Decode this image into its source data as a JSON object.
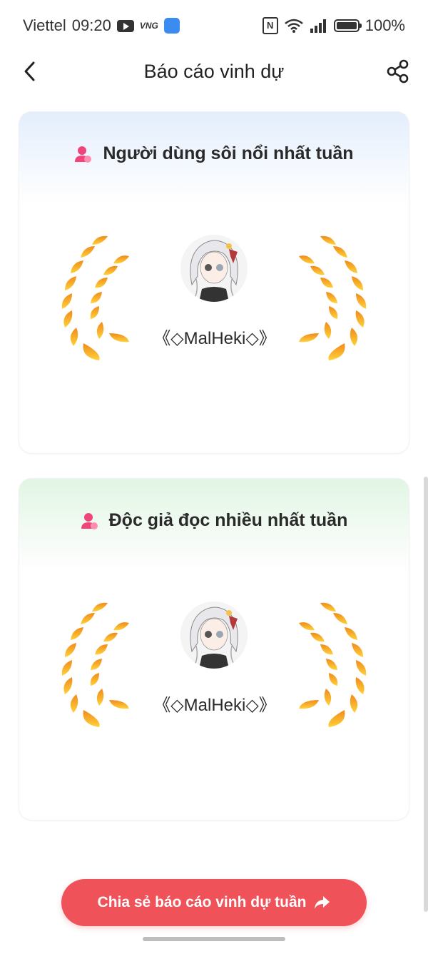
{
  "status_bar": {
    "carrier": "Viettel",
    "time": "09:20",
    "vng_label": "VNG",
    "battery": "100%"
  },
  "header": {
    "title": "Báo cáo vinh dự"
  },
  "cards": [
    {
      "title": "Người dùng sôi nổi nhất tuần",
      "username": "《◇MalHeki◇》",
      "accent": "#e3eefc"
    },
    {
      "title": "Độc giả đọc nhiều nhất tuần",
      "username": "《◇MalHeki◇》",
      "accent": "#e1f6e4"
    }
  ],
  "share_report_label": "Chia sẻ báo cáo vinh dự tuần",
  "colors": {
    "primary_button": "#f0525a",
    "laurel_light": "#ffd23a",
    "laurel_dark": "#f08a1c",
    "user_icon": "#f0457a"
  }
}
